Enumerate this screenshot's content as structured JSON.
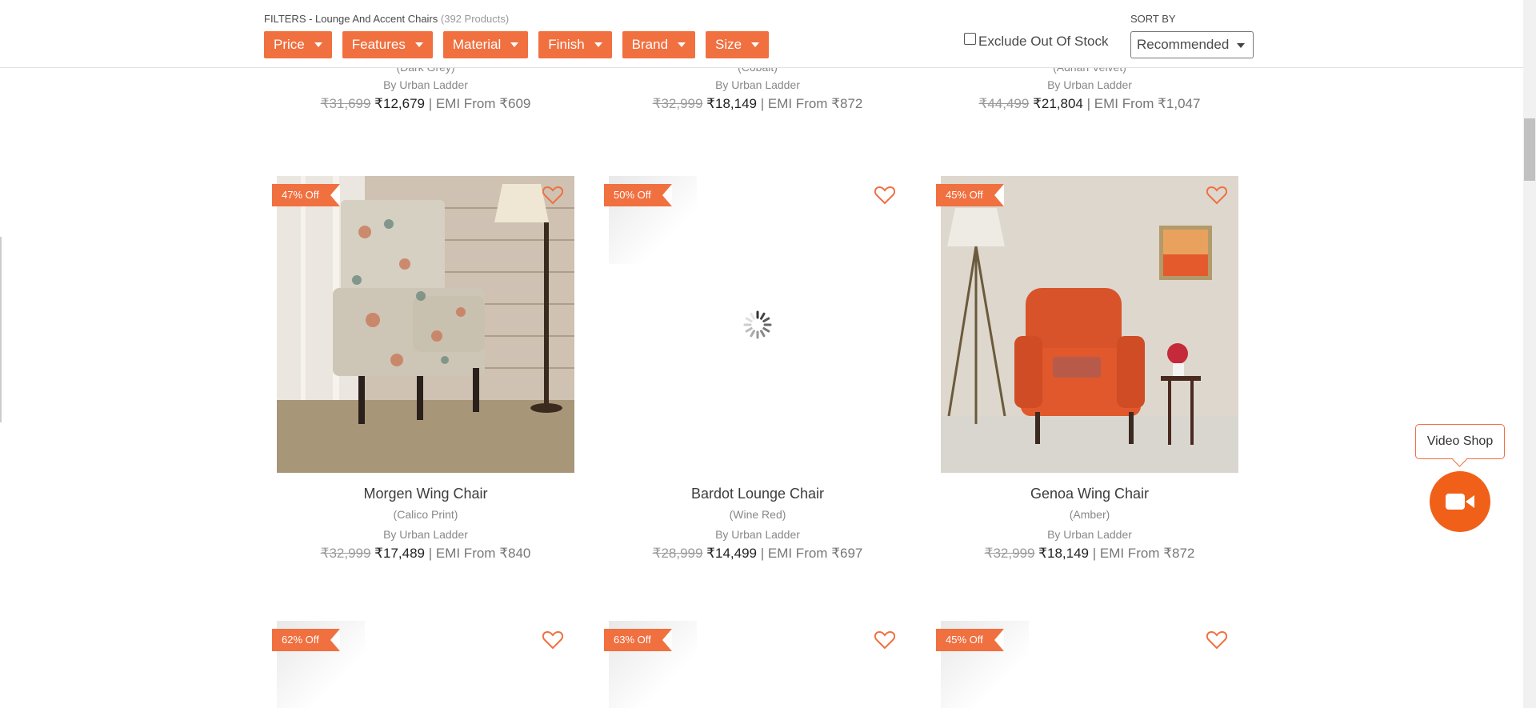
{
  "filters": {
    "title": "FILTERS - Lounge And Accent Chairs",
    "count": "(392 Products)",
    "buttons": [
      "Price",
      "Features",
      "Material",
      "Finish",
      "Brand",
      "Size"
    ],
    "exclude_label": "Exclude Out Of Stock",
    "sort_label": "SORT BY",
    "sort_value": "Recommended"
  },
  "top_row": [
    {
      "variant": "(Dark Grey)",
      "brand": "By Urban Ladder",
      "old_price": "₹31,699",
      "new_price": "₹12,679",
      "emi": "| EMI From ₹609"
    },
    {
      "variant": "(Cobalt)",
      "brand": "By Urban Ladder",
      "old_price": "₹32,999",
      "new_price": "₹18,149",
      "emi": "| EMI From ₹872"
    },
    {
      "variant": "(Adrian Velvet)",
      "brand": "By Urban Ladder",
      "old_price": "₹44,499",
      "new_price": "₹21,804",
      "emi": "| EMI From ₹1,047"
    }
  ],
  "products": [
    {
      "badge": "47% Off",
      "name": "Morgen Wing Chair",
      "variant": "(Calico Print)",
      "brand": "By Urban Ladder",
      "old_price": "₹32,999",
      "new_price": "₹17,489",
      "emi": "| EMI From ₹840"
    },
    {
      "badge": "50% Off",
      "name": "Bardot Lounge Chair",
      "variant": "(Wine Red)",
      "brand": "By Urban Ladder",
      "old_price": "₹28,999",
      "new_price": "₹14,499",
      "emi": "| EMI From ₹697"
    },
    {
      "badge": "45% Off",
      "name": "Genoa Wing Chair",
      "variant": "(Amber)",
      "brand": "By Urban Ladder",
      "old_price": "₹32,999",
      "new_price": "₹18,149",
      "emi": "| EMI From ₹872"
    }
  ],
  "next_row_badges": [
    "62% Off",
    "63% Off",
    "45% Off"
  ],
  "video_shop": {
    "label": "Video Shop"
  },
  "colors": {
    "accent": "#f07040",
    "video": "#f06018"
  }
}
